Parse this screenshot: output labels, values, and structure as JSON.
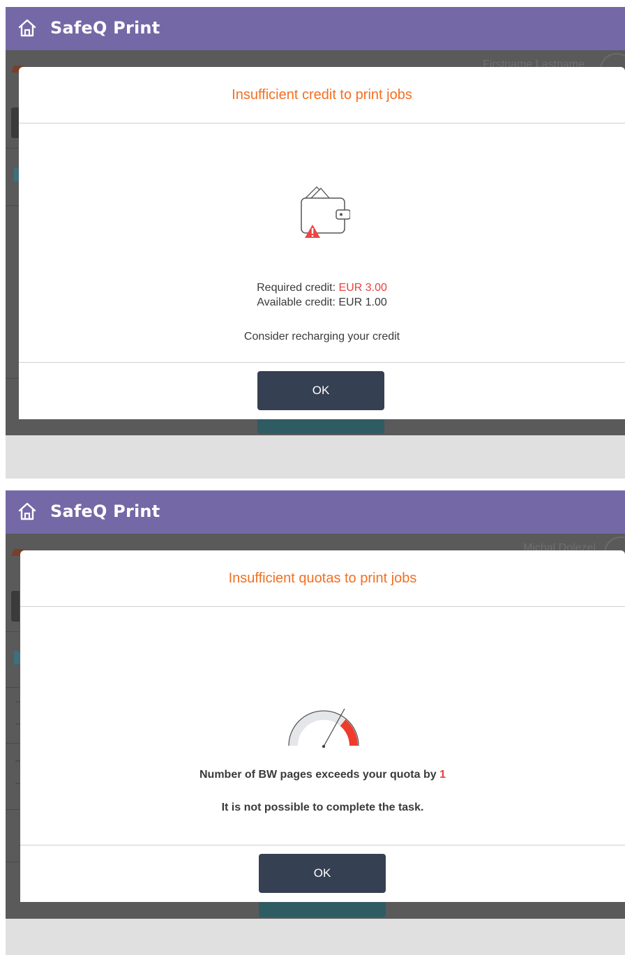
{
  "screens": [
    {
      "app_title": "SafeQ Print",
      "bg_user_name": "Firstname Lastname",
      "dialog": {
        "title": "Insufficient credit to print jobs",
        "required_label": "Required credit:",
        "required_value": "EUR 3.00",
        "available_text": "Available credit: EUR 1.00",
        "hint": "Consider recharging your credit",
        "ok_label": "OK",
        "icon": "wallet-warning-icon"
      }
    },
    {
      "app_title": "SafeQ Print",
      "bg_user_name": "Michal Dolezel",
      "dialog": {
        "title": "Insufficient quotas to print jobs",
        "exceeds_text": "Number of BW pages exceeds your quota by",
        "exceeds_value": "1",
        "not_possible_text": "It is not possible to complete the task.",
        "ok_label": "OK",
        "icon": "quota-gauge-icon"
      }
    }
  ],
  "colors": {
    "topbar": "#7469a6",
    "title_orange": "#f36f21",
    "highlight_red": "#e8413b",
    "button_dark": "#354052"
  }
}
